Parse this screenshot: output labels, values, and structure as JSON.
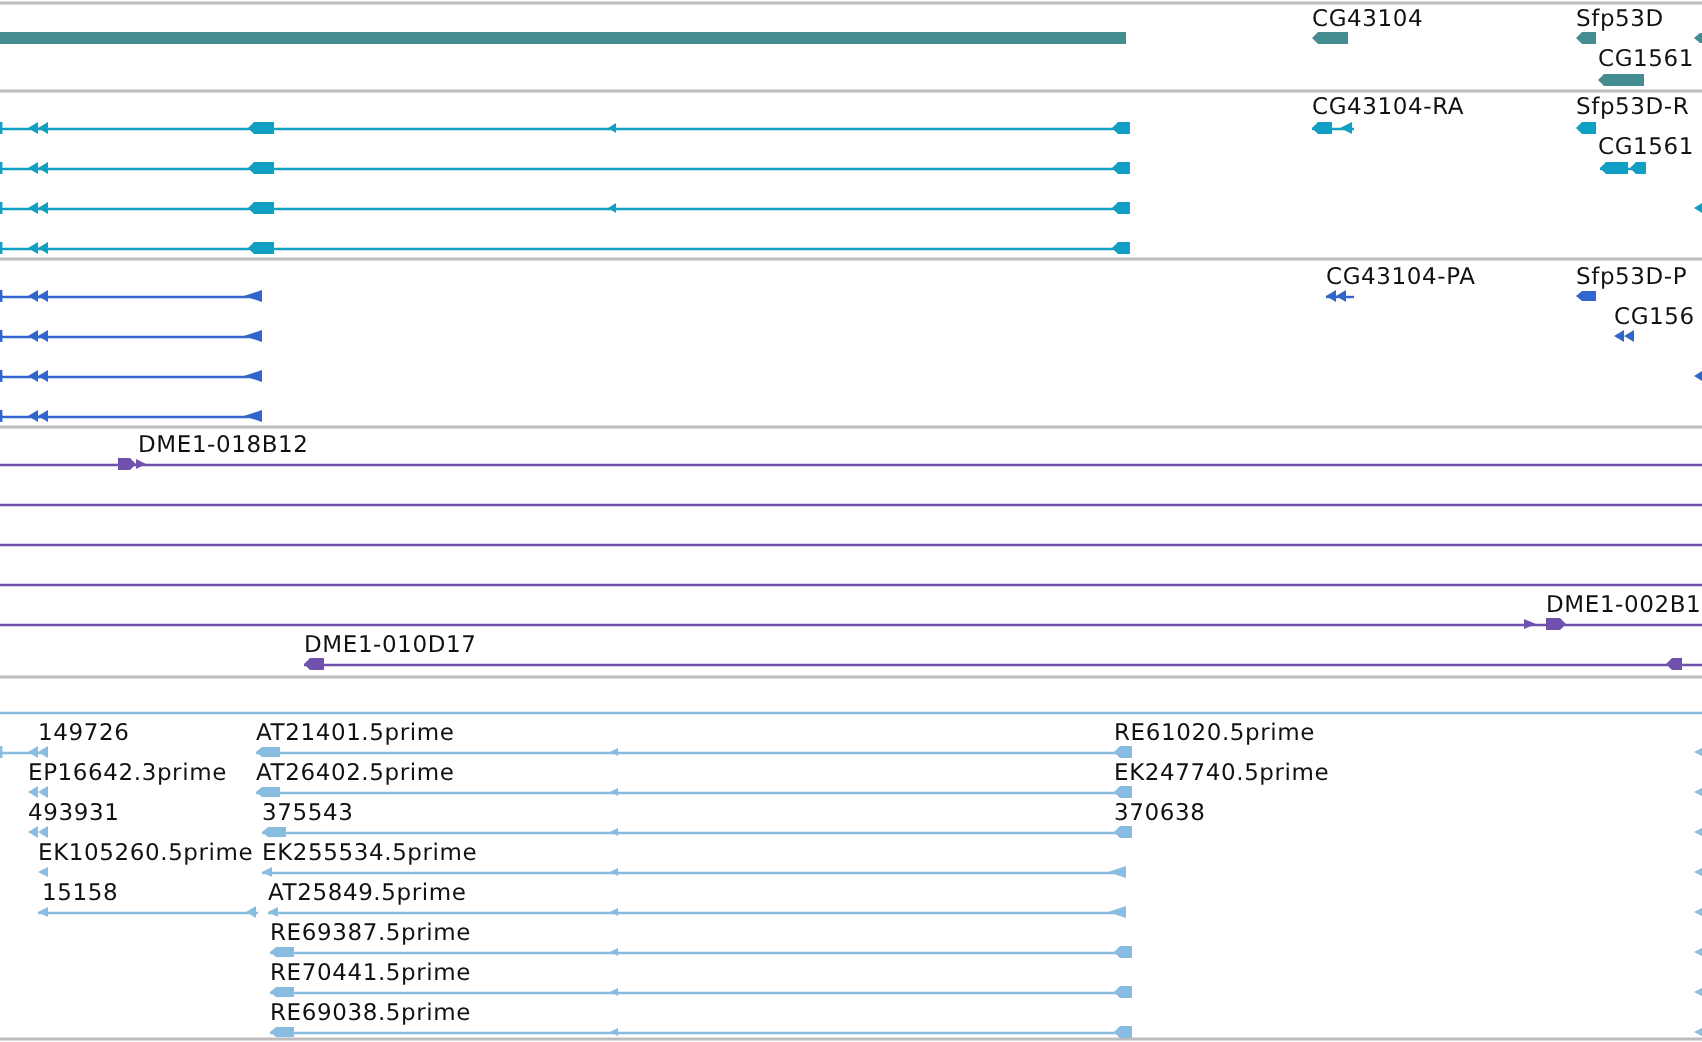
{
  "tracks": [
    {
      "kind": "gene",
      "labels": [
        "CG43104",
        "Sfp53D",
        "CG1561"
      ]
    },
    {
      "kind": "transcript",
      "labels": [
        "CG43104-RA",
        "Sfp53D-R",
        "CG1561"
      ]
    },
    {
      "kind": "protein",
      "labels": [
        "CG43104-PA",
        "Sfp53D-P",
        "CG156"
      ]
    },
    {
      "kind": "clone",
      "labels": [
        "DME1-018B12",
        "DME1-002B1",
        "DME1-010D17"
      ]
    },
    {
      "kind": "est",
      "labels": [
        "149726",
        "AT21401.5prime",
        "RE61020.5prime",
        "EP16642.3prime",
        "AT26402.5prime",
        "EK247740.5prime",
        "493931",
        "375543",
        "370638",
        "EK105260.5prime",
        "EK255534.5prime",
        "15158",
        "AT25849.5prime",
        "RE69387.5prime",
        "RE70441.5prime",
        "RE69038.5prime"
      ]
    }
  ]
}
